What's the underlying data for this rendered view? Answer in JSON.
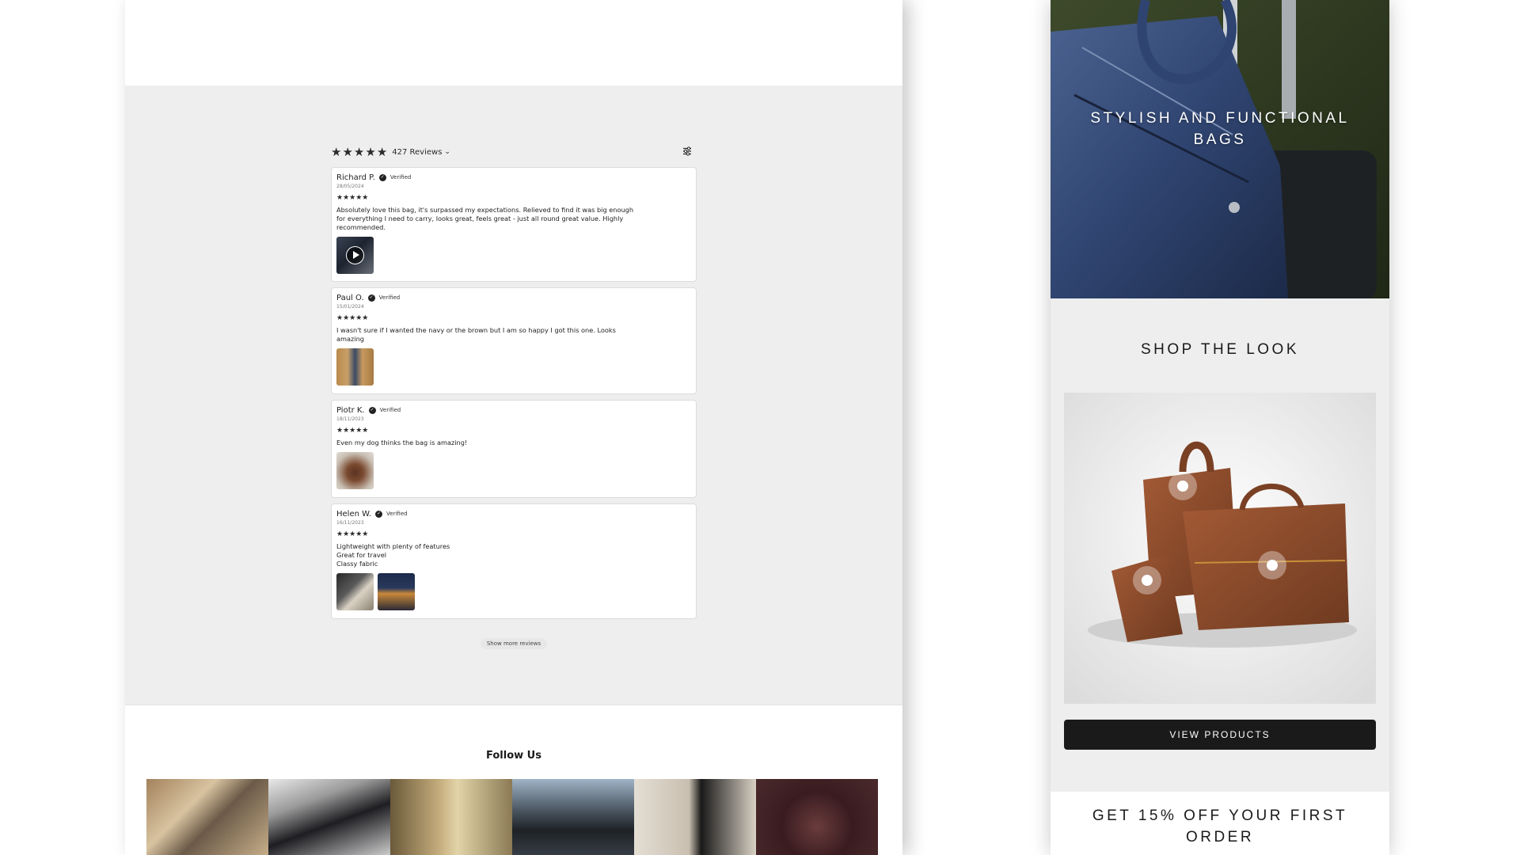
{
  "desktop": {
    "reviews": {
      "summary": {
        "rating_stars": 5,
        "count_label": "427 Reviews"
      },
      "items": [
        {
          "name": "Richard P.",
          "verified": "Verified",
          "date": "28/05/2024",
          "stars": "★★★★★",
          "text": "Absolutely love this bag, it's surpassed my expectations. Relieved to find it was big enough for everything I need to carry, looks great, feels great - just all round great value. Highly recommended.",
          "media": [
            {
              "type": "video",
              "icon": "play-icon"
            }
          ]
        },
        {
          "name": "Paul O.",
          "verified": "Verified",
          "date": "15/01/2024",
          "stars": "★★★★★",
          "text": "I wasn't sure if I wanted the navy or the brown but I am so happy I got this one. Looks amazing",
          "media": [
            {
              "type": "image"
            }
          ]
        },
        {
          "name": "Piotr K.",
          "verified": "Verified",
          "date": "18/11/2023",
          "stars": "★★★★★",
          "text": "Even my dog thinks the bag is amazing!",
          "media": [
            {
              "type": "image"
            }
          ]
        },
        {
          "name": "Helen W.",
          "verified": "Verified",
          "date": "16/11/2023",
          "stars": "★★★★★",
          "text": "Lightweight with plenty of features\nGreat for travel\nClassy fabric",
          "media": [
            {
              "type": "image"
            },
            {
              "type": "image"
            }
          ]
        }
      ],
      "show_more_label": "Show more reviews"
    },
    "follow": {
      "title": "Follow Us"
    }
  },
  "mobile": {
    "hero": {
      "title": "STYLISH AND FUNCTIONAL\nBAGS"
    },
    "shop_look": {
      "title": "SHOP THE LOOK",
      "button_label": "VIEW PRODUCTS"
    },
    "discount": {
      "title": "GET 15% OFF YOUR FIRST\nORDER"
    }
  },
  "colors": {
    "star": "#2b2b2b",
    "button": "#1a1a1a",
    "section_bg": "#eeeeee",
    "leather": "#8a4a2b",
    "navy": "#2e4468"
  },
  "icons": [
    "star-icon",
    "chevron-down-icon",
    "filter-icon",
    "verified-icon",
    "play-icon"
  ]
}
